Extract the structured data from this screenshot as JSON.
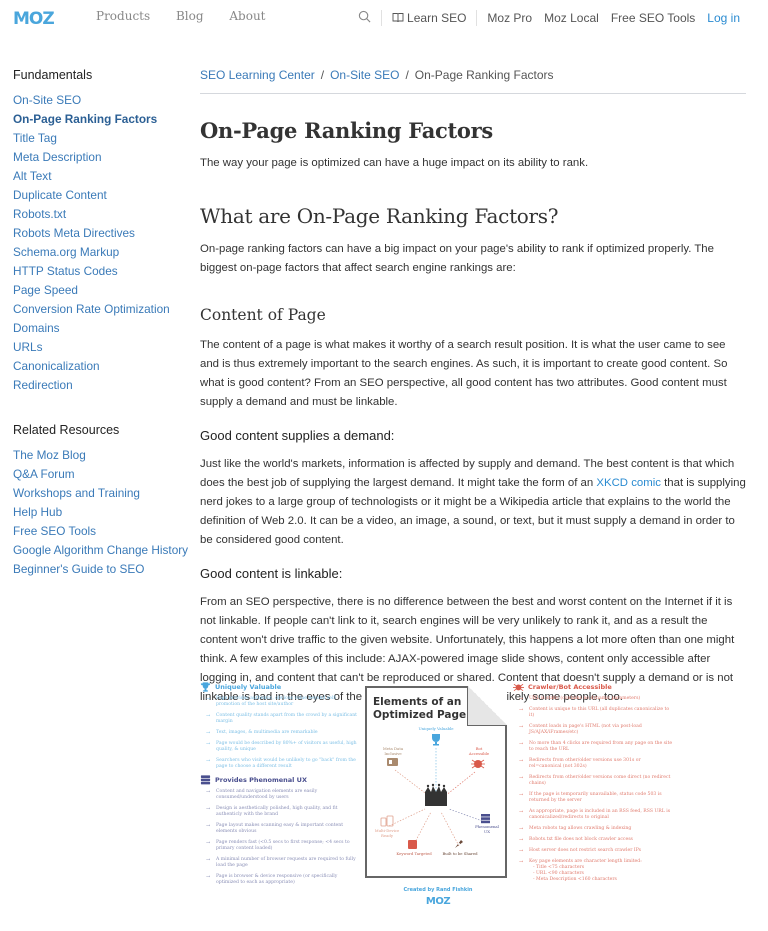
{
  "header": {
    "logo": "MOZ",
    "nav_left": [
      "Products",
      "Blog",
      "About"
    ],
    "learn_seo": "Learn SEO",
    "nav_right": [
      "Moz Pro",
      "Moz Local",
      "Free SEO Tools"
    ],
    "login": "Log in",
    "colors": {
      "brand": "#4aa6dc",
      "link": "#2a8bd1"
    }
  },
  "sidebar": {
    "fundamentals_heading": "Fundamentals",
    "fundamentals": [
      {
        "label": "On-Site SEO",
        "active": false
      },
      {
        "label": "On-Page Ranking Factors",
        "active": true
      },
      {
        "label": "Title Tag",
        "active": false
      },
      {
        "label": "Meta Description",
        "active": false
      },
      {
        "label": "Alt Text",
        "active": false
      },
      {
        "label": "Duplicate Content",
        "active": false
      },
      {
        "label": "Robots.txt",
        "active": false
      },
      {
        "label": "Robots Meta Directives",
        "active": false
      },
      {
        "label": "Schema.org Markup",
        "active": false
      },
      {
        "label": "HTTP Status Codes",
        "active": false
      },
      {
        "label": "Page Speed",
        "active": false
      },
      {
        "label": "Conversion Rate Optimization",
        "active": false
      },
      {
        "label": "Domains",
        "active": false
      },
      {
        "label": "URLs",
        "active": false
      },
      {
        "label": "Canonicalization",
        "active": false
      },
      {
        "label": "Redirection",
        "active": false
      }
    ],
    "related_heading": "Related Resources",
    "related": [
      "The Moz Blog",
      "Q&A Forum",
      "Workshops and Training",
      "Help Hub",
      "Free SEO Tools",
      "Google Algorithm Change History",
      "Beginner's Guide to SEO"
    ]
  },
  "main": {
    "breadcrumb": [
      "SEO Learning Center",
      "On-Site SEO",
      "On-Page Ranking Factors"
    ],
    "title": "On-Page Ranking Factors",
    "lead": "The way your page is optimized can have a huge impact on its ability to rank.",
    "h2": "What are On-Page Ranking Factors?",
    "intro": "On-page ranking factors can have a big impact on your page's ability to rank if optimized properly. The biggest on-page factors that affect search engine rankings are:",
    "h3": "Content of Page",
    "content_para": "The content of a page is what makes it worthy of a search result position. It is what the user came to see and is thus extremely important to the search engines. As such, it is important to create good content. So what is good content? From an SEO perspective, all good content has two attributes. Good content must supply a demand and must be linkable.",
    "demand_heading": "Good content supplies a demand:",
    "demand_para_before": "Just like the world's markets, information is affected by supply and demand. The best content is that which does the best job of supplying the largest demand. It might take the form of an ",
    "demand_link": "XKCD comic",
    "demand_para_after": " that is supplying nerd jokes to a large group of technologists or it might be a Wikipedia article that explains to the world the definition of Web 2.0. It can be a video, an image, a sound, or text, but it must supply a demand in order to be considered good content.",
    "linkable_heading": "Good content is linkable:",
    "linkable_para": "From an SEO perspective, there is no difference between the best and worst content on the Internet if it is not linkable. If people can't link to it, search engines will be very unlikely to rank it, and as a result the content won't drive traffic to the given website. Unfortunately, this happens a lot more often than one might think. A few examples of this include: AJAX-powered image slide shows, content only accessible after logging in, and content that can't be reproduced or shared. Content that doesn't supply a demand or is not linkable is bad in the eyes of the search engines—and most likely some people, too."
  },
  "infographic": {
    "title_line1": "Elements of an",
    "title_line2": "Optimized Page",
    "credit": "Created by Rand Fishkin",
    "logo": "MOZ",
    "nodes": {
      "top": "Uniquely Valuable",
      "upper_left": [
        "Meta Data",
        "Inclusive"
      ],
      "upper_right": [
        "Bot",
        "Accessible"
      ],
      "lower_left": [
        "Multi-Device",
        "Ready"
      ],
      "lower_right": [
        "Phenomenal",
        "UX"
      ],
      "bottom_left": "Keyword Targeted",
      "bottom_right": "Built to be Shared"
    },
    "uniquely_valuable": {
      "heading": "Uniquely Valuable",
      "items": [
        "Page provides authentic, obvious value beyond self-promotion of the host site/author",
        "Content quality stands apart from the crowd by a significant margin",
        "Text, images, & multimedia are remarkable",
        "Page would be described by 80%+ of visitors as useful, high quality, & unique",
        "Searchers who visit would be unlikely to go \"back\" from the page to choose a different result"
      ]
    },
    "phenomenal_ux": {
      "heading": "Provides Phenomenal UX",
      "items": [
        "Content and navigation elements are easily consumed/understood by users",
        "Design is aesthetically polished, high quality, and fit authenticly with the brand",
        "Page layout makes scanning easy & important content elements obvious",
        "Page renders fast (<0.5 secs to first response; <4 secs to primary content loaded)",
        "A minimal number of browser requests are required to fully load the page",
        "Page is browser & device responsive (or specifically optimized to each as appropriate)"
      ]
    },
    "crawler": {
      "heading": "Crawler/Bot Accessible",
      "items": [
        "URL is static (contains no dynamic parameters)",
        "Content is unique to this URL (all duplicates canonicalize to it)",
        "Content loads in page's HTML (not via post-load JS/AJAX/iFrames/etc)",
        "No more than 4 clicks are required from any page on the site to reach the URL",
        "Redirects from other/older versions use 301s or rel=canonical (not 302s)",
        "Redirects from other/older versions come direct (no redirect chains)",
        "If the page is temporarily unavailable, status code 503 is returned by the server",
        "As appropriate, page is included in an RSS feed, RSS URL is canonicalized/redirects to original",
        "Meta robots tag allows crawling & indexing",
        "Robots.txt file does not block crawler access",
        "Host server does not restrict search crawler IPs",
        "Key page elements are character length limited:"
      ],
      "sub_items": [
        "- Title <75 characters",
        "- URL <90 characters",
        "- Meta Description <160 characters"
      ]
    },
    "colors": {
      "blue": "#49a6dd",
      "navy": "#4a4f8e",
      "red": "#d9594a",
      "tan": "#a98a6e",
      "dark": "#333333"
    }
  }
}
